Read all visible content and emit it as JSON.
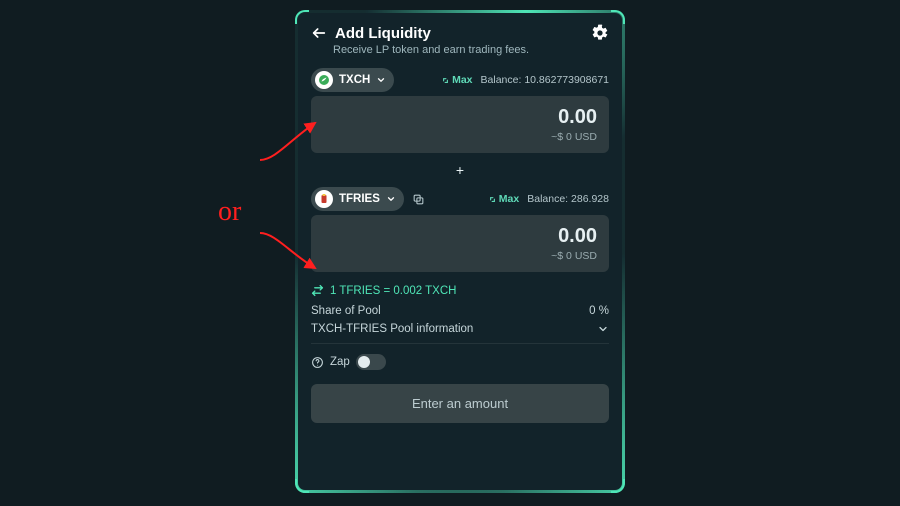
{
  "header": {
    "title": "Add Liquidity",
    "subtitle": "Receive LP token and earn trading fees."
  },
  "tokenA": {
    "symbol": "TXCH",
    "max_label": "Max",
    "balance_label": "Balance:",
    "balance": "10.862773908671",
    "amount": "0.00",
    "amount_usd": "~$ 0 USD"
  },
  "plus_label": "+",
  "tokenB": {
    "symbol": "TFRIES",
    "max_label": "Max",
    "balance_label": "Balance:",
    "balance": "286.928",
    "amount": "0.00",
    "amount_usd": "~$ 0 USD"
  },
  "rate_line": "1 TFRIES = 0.002 TXCH",
  "share": {
    "label": "Share of Pool",
    "value": "0 %"
  },
  "pool_info": {
    "label": "TXCH-TFRIES Pool information"
  },
  "zap": {
    "label": "Zap"
  },
  "submit_label": "Enter an amount",
  "annotation_or": "or",
  "colors": {
    "accent": "#4fe6b7",
    "panel": "#12232a",
    "field": "#2e3b3f",
    "chip": "#3b4a4e",
    "annot": "#ff1f1f"
  },
  "chart_data": {
    "type": "table",
    "note": "No chart in image; token pair form only."
  }
}
